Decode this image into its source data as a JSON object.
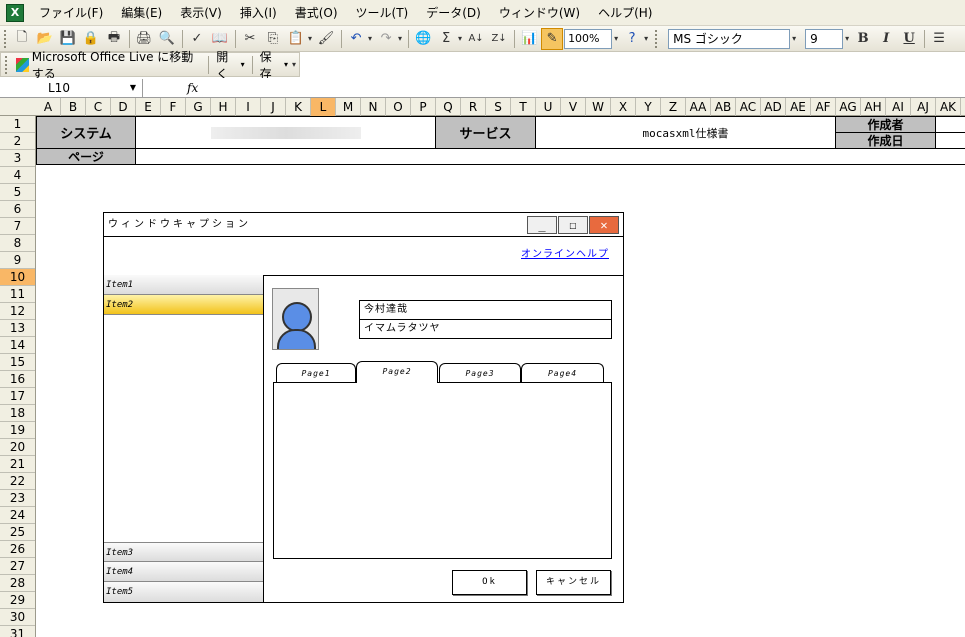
{
  "menubar": {
    "items": [
      "ファイル(F)",
      "編集(E)",
      "表示(V)",
      "挿入(I)",
      "書式(O)",
      "ツール(T)",
      "データ(D)",
      "ウィンドウ(W)",
      "ヘルプ(H)"
    ]
  },
  "toolbar": {
    "zoom": "100%",
    "font_name": "MS ゴシック",
    "font_size": "9",
    "bold": "B",
    "italic": "I",
    "underline": "U",
    "sigma": "Σ"
  },
  "toolbar2": {
    "live_label": "Microsoft Office Live に移動する",
    "open_label": "開く",
    "save_label": "保存"
  },
  "formula_bar": {
    "name_box": "L10",
    "fx": "fx"
  },
  "columns": [
    "A",
    "B",
    "C",
    "D",
    "E",
    "F",
    "G",
    "H",
    "I",
    "J",
    "K",
    "L",
    "M",
    "N",
    "O",
    "P",
    "Q",
    "R",
    "S",
    "T",
    "U",
    "V",
    "W",
    "X",
    "Y",
    "Z",
    "AA",
    "AB",
    "AC",
    "AD",
    "AE",
    "AF",
    "AG",
    "AH",
    "AI",
    "AJ",
    "AK"
  ],
  "selected_column": "L",
  "rows": [
    "1",
    "2",
    "3",
    "4",
    "5",
    "6",
    "7",
    "8",
    "9",
    "10",
    "11",
    "12",
    "13",
    "14",
    "15",
    "16",
    "17",
    "18",
    "19",
    "20",
    "21",
    "22",
    "23",
    "24",
    "25",
    "26",
    "27",
    "28",
    "29",
    "30",
    "31"
  ],
  "selected_row": "10",
  "sheet": {
    "system_label": "システム",
    "service_label": "サービス",
    "service_value": "mocasxml仕様書",
    "author_label": "作成者",
    "date_label": "作成日",
    "page_label": "ページ"
  },
  "mockup": {
    "caption": "ウィンドウキャプション",
    "help_link": "オンラインヘルプ",
    "nav_items_top": [
      "Item1",
      "Item2"
    ],
    "nav_items_bottom": [
      "Item3",
      "Item4",
      "Item5"
    ],
    "name_value": "今村達哉",
    "kana_value": "イマムラタツヤ",
    "tabs": [
      "Page1",
      "Page2",
      "Page3",
      "Page4"
    ],
    "active_tab": "Page2",
    "ok_label": "Ok",
    "cancel_label": "キャンセル"
  }
}
